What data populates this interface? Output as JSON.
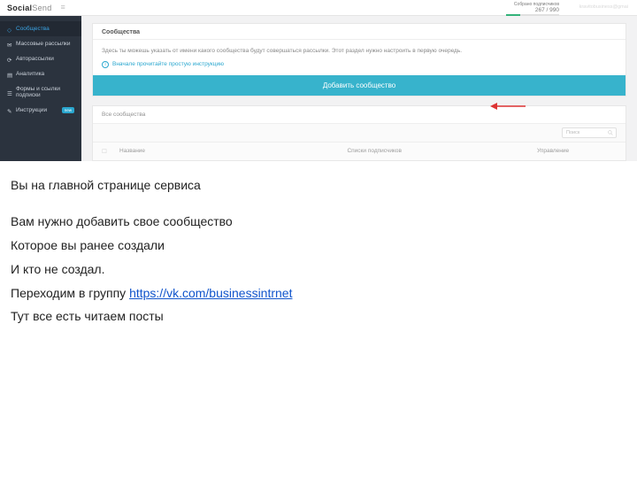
{
  "screenshot": {
    "brand": {
      "part1": "Social",
      "part2": "Send"
    },
    "stats": {
      "label": "Собрано подписчиков",
      "count": "267 / 990"
    },
    "email": "kravitobusiness@gmai",
    "sidebar": {
      "items": [
        {
          "label": "Сообщества",
          "active": true
        },
        {
          "label": "Массовые рассылки"
        },
        {
          "label": "Авторассылки"
        },
        {
          "label": "Аналитика"
        },
        {
          "label": "Формы и ссылки подписки"
        },
        {
          "label": "Инструкции",
          "badge": "new"
        }
      ]
    },
    "card": {
      "title": "Сообщества",
      "help": "Здесь ты можешь указать от имени какого сообщества будут совершаться рассылки. Этот раздел нужно настроить в первую очередь.",
      "link": "Вначале прочитайте простую инструкцию",
      "button": "Добавить сообщество"
    },
    "card2": {
      "title": "Все сообщества",
      "search_placeholder": "Поиск",
      "headers": {
        "name": "Название",
        "lists": "Списки подписчиков",
        "manage": "Управление"
      }
    }
  },
  "below": {
    "p1": "Вы на главной странице сервиса",
    "p2": "Вам нужно добавить свое сообщество",
    "p3": "Которое вы ранее создали",
    "p4": "И кто не создал.",
    "p5_prefix": "Переходим в группу  ",
    "p5_link": "https://vk.com/businessintrnet",
    "p6": "Тут все есть читаем посты"
  }
}
